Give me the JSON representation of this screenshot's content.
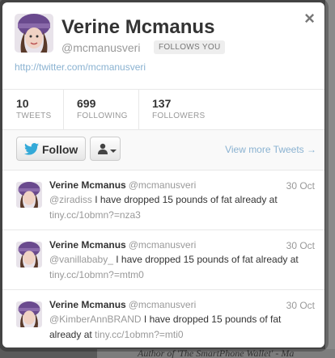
{
  "profile": {
    "name": "Verine Mcmanus",
    "handle": "@mcmanusveri",
    "follows_badge": "FOLLOWS YOU",
    "url": "http://twitter.com/mcmanusveri",
    "close_icon": "×"
  },
  "stats": [
    {
      "num": "10",
      "label": "TWEETS"
    },
    {
      "num": "699",
      "label": "FOLLOWING"
    },
    {
      "num": "137",
      "label": "FOLLOWERS"
    }
  ],
  "actions": {
    "follow_label": "Follow",
    "view_more": "View more Tweets →"
  },
  "tweets": [
    {
      "name": "Verine Mcmanus",
      "handle": "@mcmanusveri",
      "date": "30 Oct",
      "mention": "@ziradiss",
      "text": " I have dropped 15 pounds of fat already at ",
      "link": "tiny.cc/1obmn?=nza3"
    },
    {
      "name": "Verine Mcmanus",
      "handle": "@mcmanusveri",
      "date": "30 Oct",
      "mention": "@vanillababy_",
      "text": " I have dropped 15 pounds of fat already at ",
      "link": "tiny.cc/1obmn?=mtm0"
    },
    {
      "name": "Verine Mcmanus",
      "handle": "@mcmanusveri",
      "date": "30 Oct",
      "mention": "@KimberAnnBRAND",
      "text": " I have dropped 15 pounds of fat already at ",
      "link": "tiny.cc/1obmn?=mti0"
    }
  ],
  "background": {
    "bottom_text": "Author of 'The SmartPhone Wallet' - Ma"
  },
  "colors": {
    "link": "#8ab2d1",
    "twitter_bird": "#33a9d8",
    "hat_purple": "#6a4a8e"
  }
}
